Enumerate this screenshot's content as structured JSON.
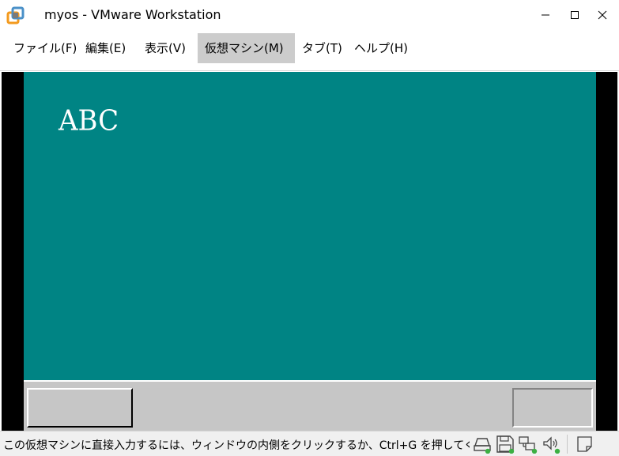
{
  "window": {
    "title": "myos - VMware Workstation",
    "controls": {
      "minimize": "minimize-icon",
      "maximize": "maximize-icon",
      "close": "close-icon"
    }
  },
  "menu": {
    "items": [
      {
        "label": "ファイル(F)"
      },
      {
        "label": "編集(E)"
      },
      {
        "label": "表示(V)"
      },
      {
        "label": "仮想マシン(M)",
        "active": true
      },
      {
        "label": "タブ(T)"
      },
      {
        "label": "ヘルプ(H)"
      }
    ]
  },
  "vm": {
    "screen_text": "ABC",
    "colors": {
      "desktop": "#008484",
      "taskbar": "#c6c6c6",
      "frame": "#000000"
    }
  },
  "statusbar": {
    "message": "この仮想マシンに直接入力するには、ウィンドウの内側をクリックするか、Ctrl+G を押してください。",
    "icons": [
      "hard-disk-icon",
      "floppy-disk-icon",
      "network-icon",
      "sound-icon",
      "notes-icon"
    ],
    "indicator_color": "#3cb043"
  }
}
